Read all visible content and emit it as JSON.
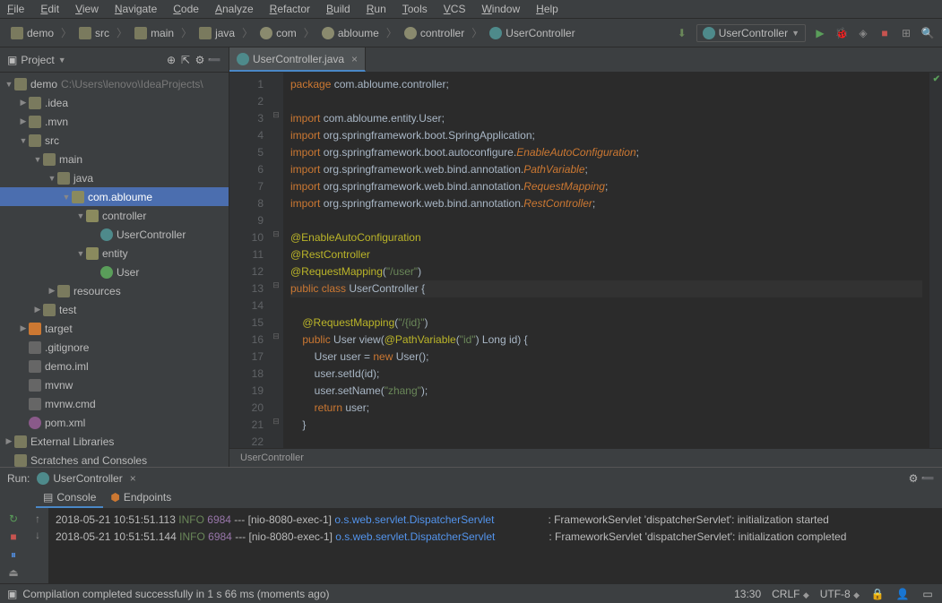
{
  "menu": [
    "File",
    "Edit",
    "View",
    "Navigate",
    "Code",
    "Analyze",
    "Refactor",
    "Build",
    "Run",
    "Tools",
    "VCS",
    "Window",
    "Help"
  ],
  "breadcrumb": [
    "demo",
    "src",
    "main",
    "java",
    "com",
    "abloume",
    "controller",
    "UserController"
  ],
  "runConfig": "UserController",
  "projectTool": {
    "title": "Project"
  },
  "tree": {
    "root": "demo",
    "rootPath": "C:\\Users\\lenovo\\IdeaProjects\\",
    "items": [
      {
        "d": 1,
        "exp": true,
        "icon": "folder",
        "label": ".idea"
      },
      {
        "d": 1,
        "exp": true,
        "icon": "folder",
        "label": ".mvn"
      },
      {
        "d": 1,
        "exp": "open",
        "icon": "folder",
        "label": "src"
      },
      {
        "d": 2,
        "exp": "open",
        "icon": "folder",
        "label": "main"
      },
      {
        "d": 3,
        "exp": "open",
        "icon": "folder",
        "label": "java"
      },
      {
        "d": 4,
        "exp": "open",
        "icon": "pkg",
        "label": "com.abloume",
        "selected": true
      },
      {
        "d": 5,
        "exp": "open",
        "icon": "pkg",
        "label": "controller"
      },
      {
        "d": 6,
        "exp": "",
        "icon": "java-class",
        "label": "UserController"
      },
      {
        "d": 5,
        "exp": "open",
        "icon": "pkg",
        "label": "entity"
      },
      {
        "d": 6,
        "exp": "",
        "icon": "java-class2",
        "label": "User"
      },
      {
        "d": 3,
        "exp": true,
        "icon": "folder",
        "label": "resources"
      },
      {
        "d": 2,
        "exp": true,
        "icon": "folder",
        "label": "test"
      },
      {
        "d": 1,
        "exp": true,
        "icon": "target",
        "label": "target"
      },
      {
        "d": 1,
        "exp": "",
        "icon": "file",
        "label": ".gitignore"
      },
      {
        "d": 1,
        "exp": "",
        "icon": "file",
        "label": "demo.iml"
      },
      {
        "d": 1,
        "exp": "",
        "icon": "file",
        "label": "mvnw"
      },
      {
        "d": 1,
        "exp": "",
        "icon": "file",
        "label": "mvnw.cmd"
      },
      {
        "d": 1,
        "exp": "",
        "icon": "m",
        "label": "pom.xml"
      }
    ],
    "extLib": "External Libraries",
    "scratches": "Scratches and Consoles"
  },
  "editorTab": "UserController.java",
  "code": {
    "lines": [
      {
        "n": 1,
        "segs": [
          [
            "kw",
            "package "
          ],
          [
            "pkg-txt",
            "com"
          ],
          [
            "",
            "."
          ],
          [
            "pkg-txt",
            "abloume"
          ],
          [
            "",
            "."
          ],
          [
            "pkg-txt",
            "controller"
          ],
          [
            "",
            ";"
          ]
        ]
      },
      {
        "n": 2,
        "segs": []
      },
      {
        "n": 3,
        "segs": [
          [
            "kw",
            "import "
          ],
          [
            "pkg-txt",
            "com"
          ],
          [
            "",
            "."
          ],
          [
            "pkg-txt",
            "abloume"
          ],
          [
            "",
            "."
          ],
          [
            "pkg-txt",
            "entity"
          ],
          [
            "",
            "."
          ],
          [
            "cls",
            "User"
          ],
          [
            "",
            ";"
          ]
        ]
      },
      {
        "n": 4,
        "segs": [
          [
            "kw",
            "import "
          ],
          [
            "pkg-txt",
            "org"
          ],
          [
            "",
            "."
          ],
          [
            "pkg-txt",
            "springframework"
          ],
          [
            "",
            "."
          ],
          [
            "pkg-txt",
            "boot"
          ],
          [
            "",
            "."
          ],
          [
            "cls",
            "SpringApplication"
          ],
          [
            "",
            ";"
          ]
        ]
      },
      {
        "n": 5,
        "segs": [
          [
            "kw",
            "import "
          ],
          [
            "pkg-txt",
            "org"
          ],
          [
            "",
            "."
          ],
          [
            "pkg-txt",
            "springframework"
          ],
          [
            "",
            "."
          ],
          [
            "pkg-txt",
            "boot"
          ],
          [
            "",
            "."
          ],
          [
            "pkg-txt",
            "autoconfigure"
          ],
          [
            "",
            "."
          ],
          [
            "imp-cls",
            "EnableAutoConfiguration"
          ],
          [
            "",
            ";"
          ]
        ]
      },
      {
        "n": 6,
        "segs": [
          [
            "kw",
            "import "
          ],
          [
            "pkg-txt",
            "org"
          ],
          [
            "",
            "."
          ],
          [
            "pkg-txt",
            "springframework"
          ],
          [
            "",
            "."
          ],
          [
            "pkg-txt",
            "web"
          ],
          [
            "",
            "."
          ],
          [
            "pkg-txt",
            "bind"
          ],
          [
            "",
            "."
          ],
          [
            "pkg-txt",
            "annotation"
          ],
          [
            "",
            "."
          ],
          [
            "imp-cls",
            "PathVariable"
          ],
          [
            "",
            ";"
          ]
        ]
      },
      {
        "n": 7,
        "segs": [
          [
            "kw",
            "import "
          ],
          [
            "pkg-txt",
            "org"
          ],
          [
            "",
            "."
          ],
          [
            "pkg-txt",
            "springframework"
          ],
          [
            "",
            "."
          ],
          [
            "pkg-txt",
            "web"
          ],
          [
            "",
            "."
          ],
          [
            "pkg-txt",
            "bind"
          ],
          [
            "",
            "."
          ],
          [
            "pkg-txt",
            "annotation"
          ],
          [
            "",
            "."
          ],
          [
            "imp-cls",
            "RequestMapping"
          ],
          [
            "",
            ";"
          ]
        ]
      },
      {
        "n": 8,
        "segs": [
          [
            "kw",
            "import "
          ],
          [
            "pkg-txt",
            "org"
          ],
          [
            "",
            "."
          ],
          [
            "pkg-txt",
            "springframework"
          ],
          [
            "",
            "."
          ],
          [
            "pkg-txt",
            "web"
          ],
          [
            "",
            "."
          ],
          [
            "pkg-txt",
            "bind"
          ],
          [
            "",
            "."
          ],
          [
            "pkg-txt",
            "annotation"
          ],
          [
            "",
            "."
          ],
          [
            "imp-cls",
            "RestController"
          ],
          [
            "",
            ";"
          ]
        ]
      },
      {
        "n": 9,
        "segs": []
      },
      {
        "n": 10,
        "segs": [
          [
            "ann",
            "@EnableAutoConfiguration"
          ]
        ]
      },
      {
        "n": 11,
        "segs": [
          [
            "ann",
            "@RestController"
          ]
        ]
      },
      {
        "n": 12,
        "segs": [
          [
            "ann",
            "@RequestMapping"
          ],
          [
            "",
            "("
          ],
          [
            "str",
            "\"/user\""
          ],
          [
            "",
            ")"
          ]
        ]
      },
      {
        "n": 13,
        "hl": true,
        "segs": [
          [
            "kw",
            "public class "
          ],
          [
            "cls",
            "UserController"
          ],
          [
            "",
            ""
          ],
          [
            "",
            ""
          ],
          [
            "",
            ""
          ],
          [
            "",
            " {"
          ]
        ]
      },
      {
        "n": 14,
        "segs": []
      },
      {
        "n": 15,
        "segs": [
          [
            "",
            "    "
          ],
          [
            "ann",
            "@RequestMapping"
          ],
          [
            "",
            "("
          ],
          [
            "str",
            "\"/{id}\""
          ],
          [
            "",
            ")"
          ]
        ]
      },
      {
        "n": 16,
        "segs": [
          [
            "",
            "    "
          ],
          [
            "kw",
            "public "
          ],
          [
            "cls",
            "User "
          ],
          [
            "",
            "view("
          ],
          [
            "ann",
            "@PathVariable"
          ],
          [
            "",
            "("
          ],
          [
            "str",
            "\"id\""
          ],
          [
            "",
            ") Long id) {"
          ]
        ]
      },
      {
        "n": 17,
        "segs": [
          [
            "",
            "        User user = "
          ],
          [
            "kw",
            "new "
          ],
          [
            "cls",
            "User"
          ],
          [
            "",
            "();"
          ]
        ]
      },
      {
        "n": 18,
        "segs": [
          [
            "",
            "        user.setId(id);"
          ]
        ]
      },
      {
        "n": 19,
        "segs": [
          [
            "",
            "        user.setName("
          ],
          [
            "str",
            "\"zhang\""
          ],
          [
            "",
            ");"
          ]
        ]
      },
      {
        "n": 20,
        "segs": [
          [
            "",
            "        "
          ],
          [
            "kw",
            "return "
          ],
          [
            "",
            "user;"
          ]
        ]
      },
      {
        "n": 21,
        "segs": [
          [
            "",
            "    }"
          ]
        ]
      },
      {
        "n": 22,
        "segs": []
      }
    ]
  },
  "breadcrumbBottom": "UserController",
  "run": {
    "title": "Run:",
    "config": "UserController",
    "tabs": [
      "Console",
      "Endpoints"
    ],
    "log": [
      {
        "ts": "2018-05-21 10:51:51.113",
        "lvl": "INFO",
        "pid": "6984",
        "thread": "[nio-8080-exec-1]",
        "comp": "o.s.web.servlet.DispatcherServlet",
        "msg": ": FrameworkServlet 'dispatcherServlet': initialization started"
      },
      {
        "ts": "2018-05-21 10:51:51.144",
        "lvl": "INFO",
        "pid": "6984",
        "thread": "[nio-8080-exec-1]",
        "comp": "o.s.web.servlet.DispatcherServlet",
        "msg": ": FrameworkServlet 'dispatcherServlet': initialization completed"
      }
    ]
  },
  "status": {
    "msg": "Compilation completed successfully in 1 s 66 ms (moments ago)",
    "time": "13:30",
    "lineEnding": "CRLF",
    "encoding": "UTF-8"
  }
}
